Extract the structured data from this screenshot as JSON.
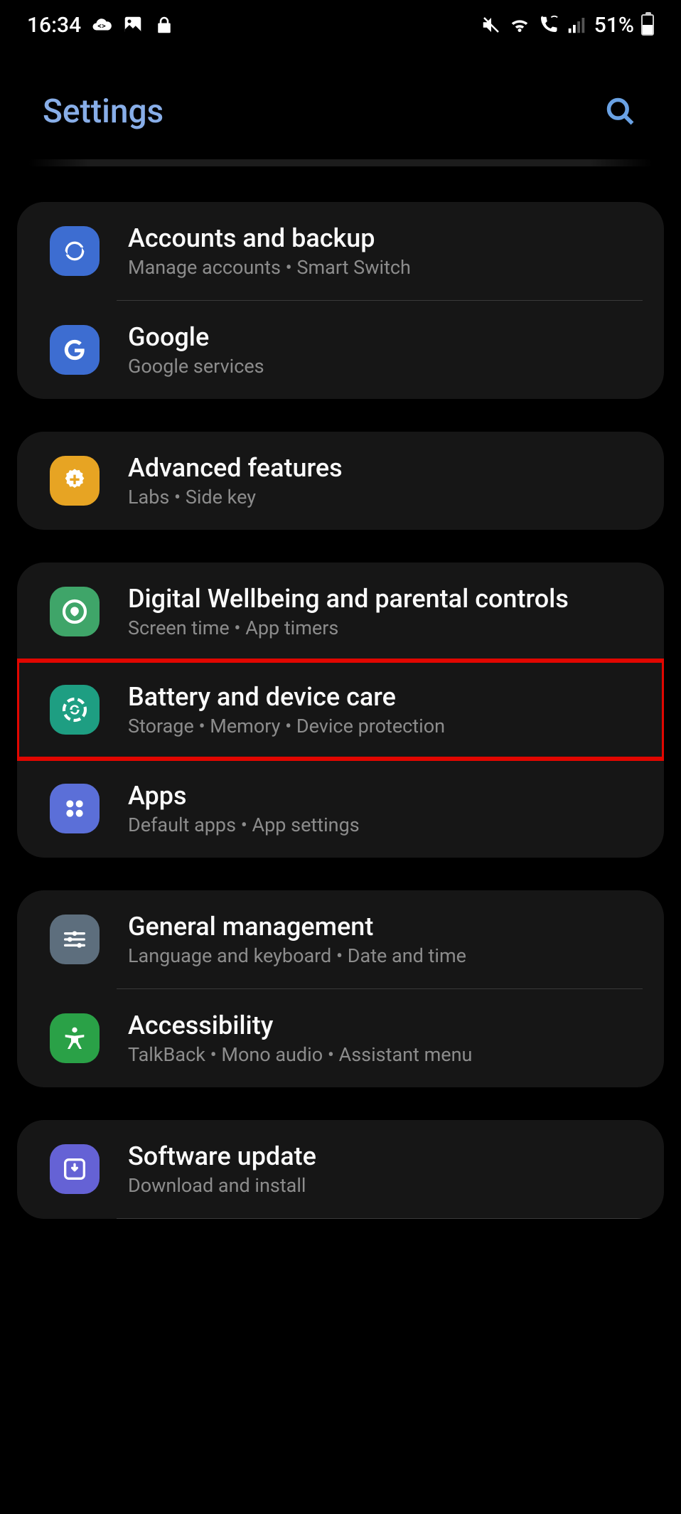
{
  "status": {
    "time": "16:34",
    "battery_pct": "51%"
  },
  "header": {
    "title": "Settings"
  },
  "groups": [
    {
      "items": [
        {
          "title": "Accounts and backup",
          "sub": "Manage accounts  •  Smart Switch"
        },
        {
          "title": "Google",
          "sub": "Google services"
        }
      ]
    },
    {
      "items": [
        {
          "title": "Advanced features",
          "sub": "Labs  •  Side key"
        }
      ]
    },
    {
      "items": [
        {
          "title": "Digital Wellbeing and parental controls",
          "sub": "Screen time  •  App timers"
        },
        {
          "title": "Battery and device care",
          "sub": "Storage  •  Memory  •  Device protection"
        },
        {
          "title": "Apps",
          "sub": "Default apps  •  App settings"
        }
      ]
    },
    {
      "items": [
        {
          "title": "General management",
          "sub": "Language and keyboard  •  Date and time"
        },
        {
          "title": "Accessibility",
          "sub": "TalkBack  •  Mono audio  •  Assistant menu"
        }
      ]
    },
    {
      "items": [
        {
          "title": "Software update",
          "sub": "Download and install"
        }
      ]
    }
  ]
}
